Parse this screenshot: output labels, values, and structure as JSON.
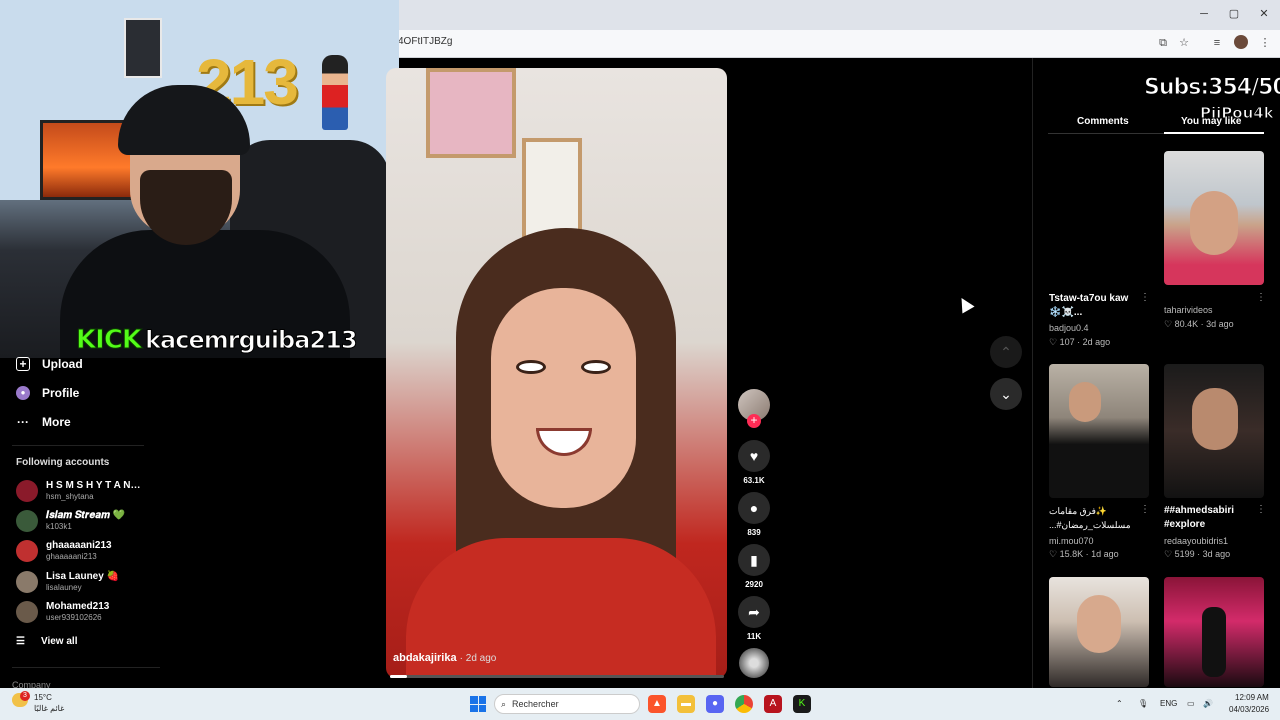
{
  "browser": {
    "url_fragment": "4OFtITJBZg",
    "window_controls": {
      "minimize": "─",
      "maximize": "▢",
      "close": "✕"
    },
    "toolbar_icons": [
      "install-app-icon",
      "bookmark-star-icon",
      "media-icon",
      "profile-avatar",
      "kebab-menu-icon"
    ]
  },
  "stream_overlay": {
    "kick_logo": "KICK",
    "kick_channel": "kacemrguiba213",
    "balloon_text": "213",
    "subs_text": "Subs:354/500",
    "subs_user": "PiiPou4k"
  },
  "sidebar": {
    "items": [
      {
        "label": "Upload",
        "icon": "plus-square-icon",
        "glyph": "+"
      },
      {
        "label": "Profile",
        "icon": "profile-icon",
        "glyph": "●"
      },
      {
        "label": "More",
        "icon": "more-dots-icon",
        "glyph": "···"
      }
    ],
    "following_title": "Following accounts",
    "accounts": [
      {
        "name": "H S M  S H Y T A N…",
        "username": "hsm_shytana",
        "color": "#8a1a2a"
      },
      {
        "name": "𝑰𝒔𝒍𝒂𝒎 𝑺𝒕𝒓𝒆𝒂𝒎 💚",
        "username": "k103k1",
        "color": "#3a5a3a"
      },
      {
        "name": "ghaaaaani213",
        "username": "ghaaaaani213",
        "color": "#c03030"
      },
      {
        "name": "Lisa Launey 🍓",
        "username": "lisalauney",
        "color": "#8a7a6a"
      },
      {
        "name": "Mohamed213",
        "username": "user939102626",
        "color": "#6a5a4a"
      }
    ],
    "view_all": "View all",
    "company": "Company"
  },
  "video": {
    "author": "abdakajirika",
    "time_ago": "· 2d ago",
    "progress_fraction": 0.05
  },
  "actions": [
    {
      "name": "like-icon",
      "glyph": "♥",
      "count": "63.1K"
    },
    {
      "name": "comment-icon",
      "glyph": "●",
      "count": "839"
    },
    {
      "name": "bookmark-icon",
      "glyph": "▮",
      "count": "2920"
    },
    {
      "name": "share-icon",
      "glyph": "➦",
      "count": "11K"
    }
  ],
  "nav": {
    "up": "⌃",
    "down": "⌄"
  },
  "right_panel": {
    "tabs": {
      "comments": "Comments",
      "you_may_like": "You may like"
    },
    "cards": [
      {
        "title": "Tstaw-ta7ou kaw ❄️☠️...",
        "user": "badjou0.4",
        "likes": "♡ 107",
        "time": "· 2d ago",
        "thumb": "dark"
      },
      {
        "title": "",
        "user": "taharivideos",
        "likes": "♡ 80.4K",
        "time": "· 3d ago",
        "thumb": "snow-man"
      },
      {
        "title": "✨فرق مقامات مسلسلات_رمضان#...",
        "user": "mi.mou070",
        "likes": "♡ 15.8K",
        "time": "· 1d ago",
        "thumb": "people"
      },
      {
        "title": "##ahmedsabiri #explore",
        "user": "redaayoubidris1",
        "likes": "♡ 5199",
        "time": "· 3d ago",
        "thumb": "bandage"
      },
      {
        "title": "",
        "user": "",
        "likes": "",
        "time": "",
        "thumb": "teen"
      },
      {
        "title": "",
        "user": "",
        "likes": "",
        "time": "",
        "thumb": "stage"
      }
    ]
  },
  "taskbar": {
    "weather_temp": "15°C",
    "weather_desc": "غائم غالبًا",
    "weather_badge": "3",
    "search_placeholder": "Rechercher",
    "language": "ENG",
    "time": "12:09 AM",
    "date": "04/03/2026"
  }
}
